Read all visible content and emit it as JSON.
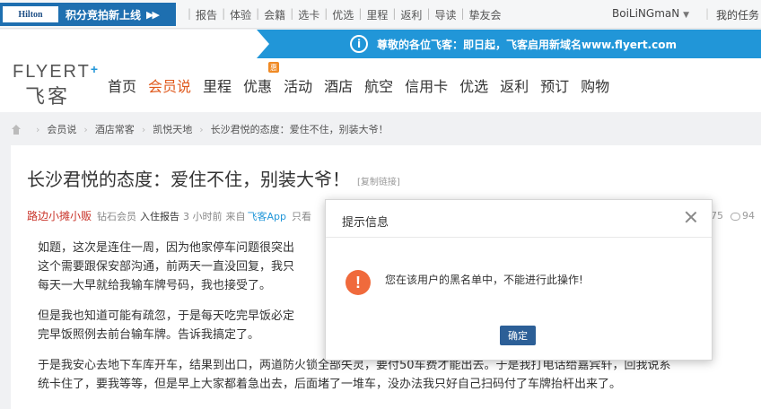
{
  "topbar": {
    "hilton_logo": "Hilton",
    "hilton_text": "积分竞拍新上线",
    "hilton_arrows": "▶▶",
    "nav": [
      "报告",
      "体验",
      "会籍",
      "选卡",
      "优选",
      "里程",
      "返利",
      "导读",
      "挚友会"
    ],
    "username": "BoiLiNGmaN",
    "task": "我的任务"
  },
  "notice": {
    "icon": "i",
    "text": "尊敬的各位飞客：即日起，飞客启用新域名www.flyert.com"
  },
  "logo": {
    "en": "FLYERT",
    "cn": "飞客"
  },
  "mainnav": [
    "首页",
    "会员说",
    "里程",
    "优惠",
    "活动",
    "酒店",
    "航空",
    "信用卡",
    "优选",
    "返利",
    "预订",
    "购物"
  ],
  "hot_badge": "惠",
  "breadcrumb": [
    "会员说",
    "酒店常客",
    "凯悦天地",
    "长沙君悦的态度：爱住不住，别装大爷！"
  ],
  "article": {
    "title": "长沙君悦的态度：爱住不住，别装大爷！",
    "copy_link": "[复制链接]",
    "author": "路边小摊小贩",
    "level": "钻石会员",
    "category": "入住报告",
    "time": "3 小时前",
    "source_prefix": "来自",
    "source_app": "飞客App",
    "tail": "只看",
    "views": "75",
    "comments": "94",
    "paragraphs": [
      "如题，这次是连住一周，因为他家停车问题很突出                                                                  复说\n这个需要跟保安部沟通，前两天一直没回复，我只                                                                  员工\n每天一大早就给我输车牌号码，我也接受了。",
      "但是我也知道可能有疏忽，于是每天吃完早饭必定                                                                  我吃\n完早饭照例去前台输车牌。告诉我搞定了。",
      "于是我安心去地下车库开车，结果到出口，两道防火锁全部失灵，要付50车费才能出去。于是我打电话给嘉宾轩，回我说系\n统卡住了，要我等等，但是早上大家都着急出去，后面堵了一堆车，没办法我只好自己扫码付了车牌抬杆出来了。"
    ]
  },
  "modal": {
    "title": "提示信息",
    "icon": "!",
    "message": "您在该用户的黑名单中，不能进行此操作!",
    "ok_label": "确定"
  }
}
